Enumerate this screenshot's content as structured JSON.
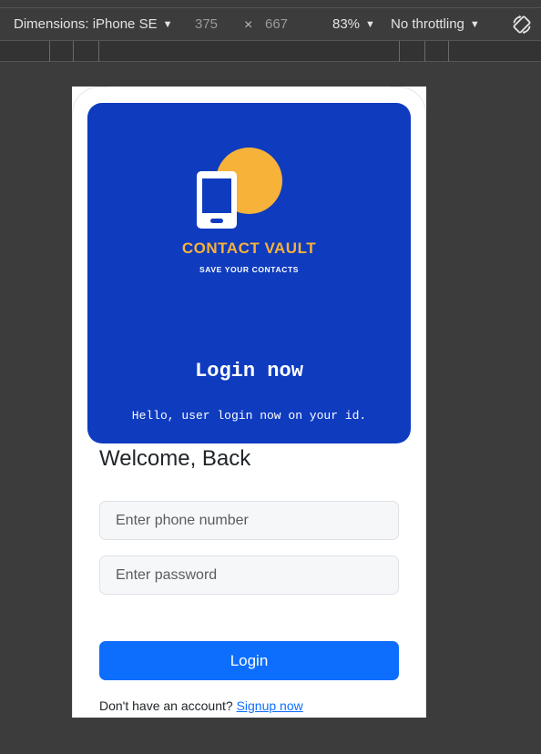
{
  "devtools": {
    "dimensions_label": "Dimensions: iPhone SE",
    "width": "375",
    "times": "×",
    "height": "667",
    "zoom": "83%",
    "throttling": "No throttling",
    "icons": [
      "caret-down-icon",
      "rotate-icon"
    ]
  },
  "app": {
    "brand_name": "CONTACT VAULT",
    "brand_tagline": "SAVE YOUR CONTACTS",
    "hero_title": "Login now",
    "hero_subtitle": "Hello, user login now on your id.",
    "welcome": "Welcome, Back",
    "phone_placeholder": "Enter phone number",
    "password_placeholder": "Enter password",
    "login_label": "Login",
    "signup_prompt": "Don't have an account?",
    "signup_link": "Signup now",
    "colors": {
      "hero_bg": "#0f3bbf",
      "brand_accent": "#f7b23a",
      "primary_button": "#0d6efd"
    }
  }
}
